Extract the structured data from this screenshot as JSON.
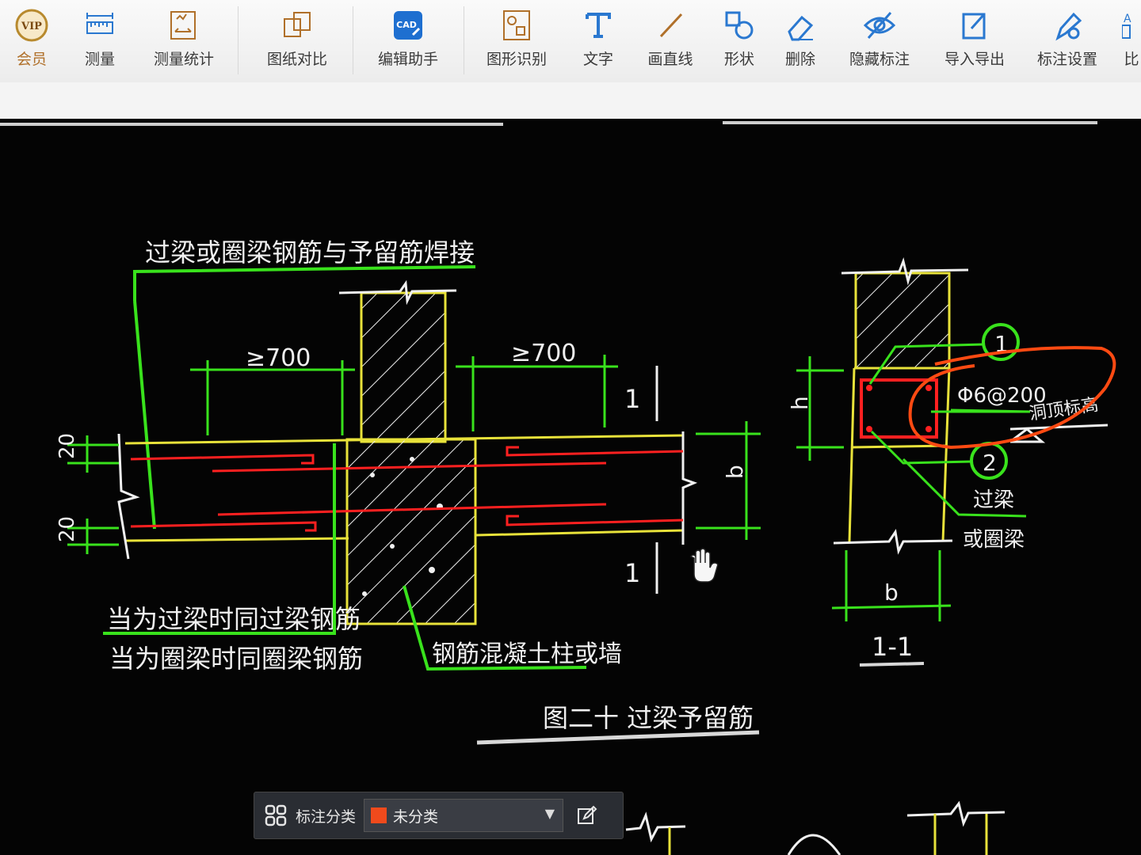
{
  "toolbar": {
    "vip_label": "会员",
    "measure": "测量",
    "measure_stats": "测量统计",
    "compare": "图纸对比",
    "edit_assist": "编辑助手",
    "shape_recog": "图形识别",
    "text": "文字",
    "line": "画直线",
    "shape": "形状",
    "delete": "删除",
    "hide_anno": "隐藏标注",
    "import_export": "导入导出",
    "anno_settings": "标注设置",
    "more": "比"
  },
  "drawing": {
    "weld_note": "过梁或圈梁钢筋与予留筋焊接",
    "dim_left": "≥700",
    "dim_right": "≥700",
    "dim_20_top": "20",
    "dim_20_bottom": "20",
    "section_mark_top": "1",
    "section_mark_bottom": "1",
    "dim_b_elev": "b",
    "note_lintel": "当为过梁时同过梁钢筋",
    "note_ring": "当为圈梁时同圈梁钢筋",
    "column_note": "钢筋混凝土柱或墙",
    "figure_title": "图二十  过梁予留筋",
    "section_h": "h",
    "rebar_spec": "Φ6@200",
    "opening_top": "洞顶标高",
    "bubble_1": "1",
    "bubble_2": "2",
    "lintel_note_1": "过梁",
    "lintel_note_2": "或圈梁",
    "section_b": "b",
    "section_title": "1-1"
  },
  "annotation_bar": {
    "label": "标注分类",
    "selected": "未分类",
    "swatch_color": "#f04a1c"
  },
  "colors": {
    "cad_background": "#040404",
    "green": "#39e21c",
    "yellow": "#e8e23a",
    "red": "#ff2020",
    "markup_orange": "#ff4a12"
  }
}
